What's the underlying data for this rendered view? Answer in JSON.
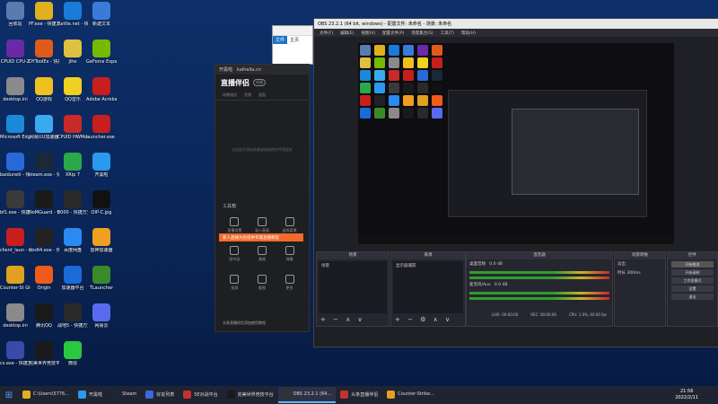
{
  "colors": {
    "desktop": "#0b2a5e",
    "accent": "#f06a2c",
    "obs_bg": "#1f1f26"
  },
  "desktop_icons": [
    {
      "label": "回收站",
      "color": "#5a7bb0"
    },
    {
      "label": "PF.exe - 快捷方式",
      "color": "#e0b020"
    },
    {
      "label": "Battle.net - 快捷方式",
      "color": "#1a7bd8"
    },
    {
      "label": "新建文本",
      "color": "#3a7bd8"
    },
    {
      "label": "CPUID CPU-Z",
      "color": "#6a2aa8"
    },
    {
      "label": "DYToolEx - 快捷方式",
      "color": "#e05a1a"
    },
    {
      "label": "jihe",
      "color": "#e0c040"
    },
    {
      "label": "GeForce Experience",
      "color": "#76b900"
    },
    {
      "label": "desktop.ini",
      "color": "#8a8a8a"
    },
    {
      "label": "QQ游戏",
      "color": "#f0c020"
    },
    {
      "label": "QQ音乐",
      "color": "#f0d020"
    },
    {
      "label": "Adobe Acrobat DC",
      "color": "#c81e1e"
    },
    {
      "label": "Microsoft Edge",
      "color": "#1a8ad8"
    },
    {
      "label": "网易UU加速器",
      "color": "#3aaaf0"
    },
    {
      "label": "CPUID HWMonitor",
      "color": "#c82a2a"
    },
    {
      "label": "launcher.exe - 快捷方式",
      "color": "#c81e1e"
    },
    {
      "label": "baiduneti - 快捷方式",
      "color": "#2a6ad8"
    },
    {
      "label": "steam.exe - 快捷方式",
      "color": "#1b2838"
    },
    {
      "label": "XRip 7",
      "color": "#2aa84a"
    },
    {
      "label": "开黑啦",
      "color": "#2a9af0"
    },
    {
      "label": "bf1.exe - 快捷方式",
      "color": "#3a3a3a"
    },
    {
      "label": "NoMGuard - 快捷方式",
      "color": "#1a1a1a"
    },
    {
      "label": "8000 - 快捷方式",
      "color": "#2a2a2a"
    },
    {
      "label": "OIP-C.jpg",
      "color": "#111111"
    },
    {
      "label": "client_laun - 快捷方式",
      "color": "#c81e1e"
    },
    {
      "label": "obs64.exe - 快捷方式",
      "color": "#222222"
    },
    {
      "label": "百度网盘",
      "color": "#2a8af0"
    },
    {
      "label": "雷神加速器",
      "color": "#f0a020"
    },
    {
      "label": "Counter-St Global Off",
      "color": "#e0a020"
    },
    {
      "label": "Origin",
      "color": "#f05a1a"
    },
    {
      "label": "加速器平台",
      "color": "#1a6ad8"
    },
    {
      "label": "TLauncher",
      "color": "#3a8a2a"
    },
    {
      "label": "desktop.ini",
      "color": "#8a8a8a"
    },
    {
      "label": "腾讯QQ",
      "color": "#1a1a1a"
    },
    {
      "label": "战地5 - 快捷方式",
      "color": "#2a2a2a"
    },
    {
      "label": "网易云",
      "color": "#5a6af0"
    },
    {
      "label": "cs.exe - 快捷方式",
      "color": "#3a4aa8"
    },
    {
      "label": "完美世界竞技平台",
      "color": "#1a1a1a"
    },
    {
      "label": "微信",
      "color": "#2ac840"
    }
  ],
  "explorer": {
    "tab_file": "文件",
    "tab_home": "主页"
  },
  "liveapp": {
    "title": "开黑啦",
    "url": "kaiheila.cn",
    "brand": "直播伴侣",
    "brand_tag": "内测",
    "tabs": [
      "场景描述",
      "音频",
      "画面"
    ],
    "hint": "点击加号添加场景或者拖拽文件到此处",
    "tools_label": "工具箱",
    "banner": "新人直播为您提供专属直播教程",
    "tools": [
      "直播设置",
      "录入画面",
      "虚拟背景",
      "画中画",
      "美颜",
      "弹幕",
      "投屏",
      "截图",
      "更多"
    ],
    "bottom": "头条直播伴侣添加使用教程"
  },
  "obs": {
    "title": "OBS 23.2.1 (64 bit, windows) - 配置文件: 未命名 - 场景: 未命名",
    "menu": [
      "文件(F)",
      "编辑(E)",
      "视图(V)",
      "配置文件(P)",
      "场景集合(S)",
      "工具(T)",
      "帮助(H)"
    ],
    "docks": {
      "scenes": {
        "title": "场景",
        "items": [
          "场景"
        ]
      },
      "sources": {
        "title": "来源",
        "items": [
          "显示器捕获"
        ]
      },
      "mixer": {
        "title": "混音器",
        "items": [
          "桌面音频",
          "麦克风/Aux"
        ],
        "db": "0.0 dB"
      },
      "transitions": {
        "title": "场景转换",
        "type": "淡出",
        "duration_label": "时长",
        "duration": "300ms"
      },
      "controls": {
        "title": "控件",
        "buttons": [
          "开始推流",
          "开始录制",
          "工作室模式",
          "设置",
          "退出"
        ]
      }
    },
    "status": {
      "live": "LIVE: 00:00:00",
      "rec": "REC: 00:00:00",
      "cpu": "CPU: 1.0%, 60.00 fps"
    }
  },
  "taskbar": {
    "items": [
      {
        "label": "C:\\Users\\5776...",
        "color": "#e0b020"
      },
      {
        "label": "开黑啦",
        "color": "#2a9af0"
      },
      {
        "label": "Steam",
        "color": "#1b2838"
      },
      {
        "label": "好友列表",
        "color": "#3a6ad8"
      },
      {
        "label": "5E对战平台",
        "color": "#c83030"
      },
      {
        "label": "完美世界竞技平台",
        "color": "#1a1a1a"
      },
      {
        "label": "OBS 23.2.1 (64...",
        "color": "#333333"
      },
      {
        "label": "头条直播伴侣",
        "color": "#c83030"
      },
      {
        "label": "Counter-Strike...",
        "color": "#e0a020"
      }
    ],
    "time": "21:56",
    "date": "2022/2/11"
  }
}
